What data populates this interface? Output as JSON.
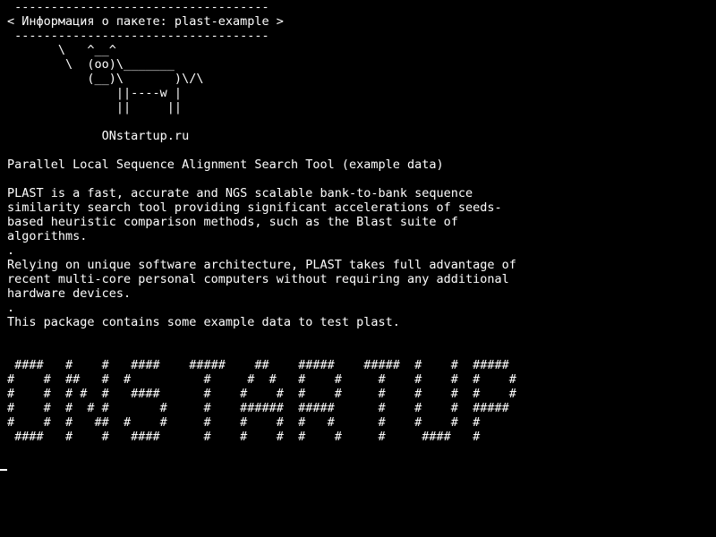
{
  "terminal": {
    "lines": [
      " -----------------------------------",
      "< Информация о пакете: plast-example >",
      " -----------------------------------",
      "       \\   ^__^",
      "        \\  (oo)\\_______",
      "           (__)\\       )\\/\\",
      "               ||----w |",
      "               ||     ||",
      "",
      "             ONstartup.ru",
      "",
      "Parallel Local Sequence Alignment Search Tool (example data)",
      "",
      "PLAST is a fast, accurate and NGS scalable bank-to-bank sequence",
      "similarity search tool providing significant accelerations of seeds-",
      "based heuristic comparison methods, such as the Blast suite of",
      "algorithms.",
      ".",
      "Relying on unique software architecture, PLAST takes full advantage of",
      "recent multi-core personal computers without requiring any additional",
      "hardware devices.",
      ".",
      "This package contains some example data to test plast.",
      "",
      "",
      " ####   #    #   ####    #####    ##    #####    #####  #    #  #####",
      "#    #  ##   #  #          #     #  #   #    #     #    #    #  #    #",
      "#    #  # #  #   ####      #    #    #  #    #     #    #    #  #    #",
      "#    #  #  # #       #     #    ######  #####      #    #    #  #####",
      "#    #  #   ##  #    #     #    #    #  #   #      #    #    #  #",
      " ####   #    #   ####      #    #    #  #    #     #     ####   #",
      "",
      ""
    ]
  }
}
